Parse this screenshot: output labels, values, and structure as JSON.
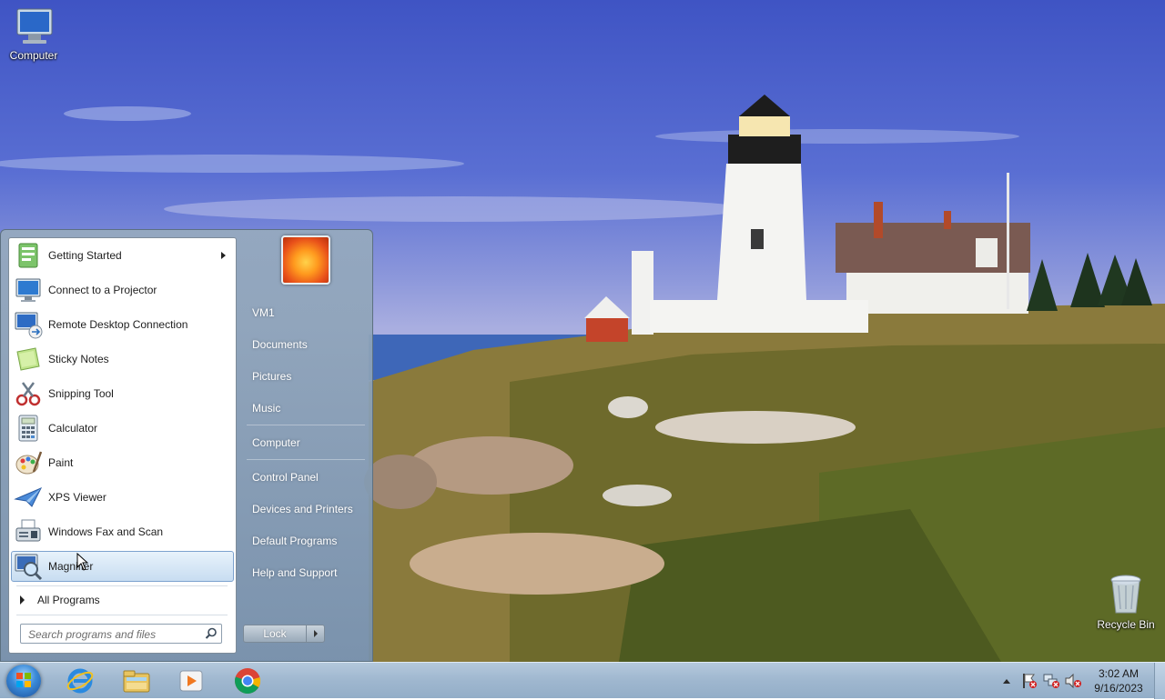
{
  "desktop": {
    "icons": [
      {
        "label": "Computer",
        "icon": "computer-icon"
      },
      {
        "label": "Recycle Bin",
        "icon": "recycle-bin-icon"
      }
    ]
  },
  "start_menu": {
    "programs": [
      {
        "label": "Getting Started",
        "icon": "getting-started-icon",
        "has_submenu": true
      },
      {
        "label": "Connect to a Projector",
        "icon": "projector-icon"
      },
      {
        "label": "Remote Desktop Connection",
        "icon": "remote-desktop-icon"
      },
      {
        "label": "Sticky Notes",
        "icon": "sticky-notes-icon"
      },
      {
        "label": "Snipping Tool",
        "icon": "snipping-tool-icon"
      },
      {
        "label": "Calculator",
        "icon": "calculator-icon"
      },
      {
        "label": "Paint",
        "icon": "paint-icon"
      },
      {
        "label": "XPS Viewer",
        "icon": "xps-viewer-icon"
      },
      {
        "label": "Windows Fax and Scan",
        "icon": "fax-scan-icon"
      },
      {
        "label": "Magnifier",
        "icon": "magnifier-icon",
        "selected": true
      }
    ],
    "all_programs": "All Programs",
    "search_placeholder": "Search programs and files",
    "right_items": [
      "VM1",
      "Documents",
      "Pictures",
      "Music",
      "Computer",
      "Control Panel",
      "Devices and Printers",
      "Default Programs",
      "Help and Support"
    ],
    "lock_label": "Lock"
  },
  "taskbar": {
    "pinned": [
      {
        "name": "internet-explorer-icon"
      },
      {
        "name": "file-explorer-icon"
      },
      {
        "name": "media-player-icon"
      },
      {
        "name": "chrome-icon"
      }
    ],
    "tray_icons": [
      "show-hidden-icons-icon",
      "action-center-icon",
      "network-icon",
      "volume-muted-icon"
    ],
    "clock": {
      "time": "3:02 AM",
      "date": "9/16/2023"
    }
  },
  "colors": {
    "selection": "#c8ddf1",
    "taskbar": "#9fb7cf",
    "sky": "#4a60cc"
  }
}
